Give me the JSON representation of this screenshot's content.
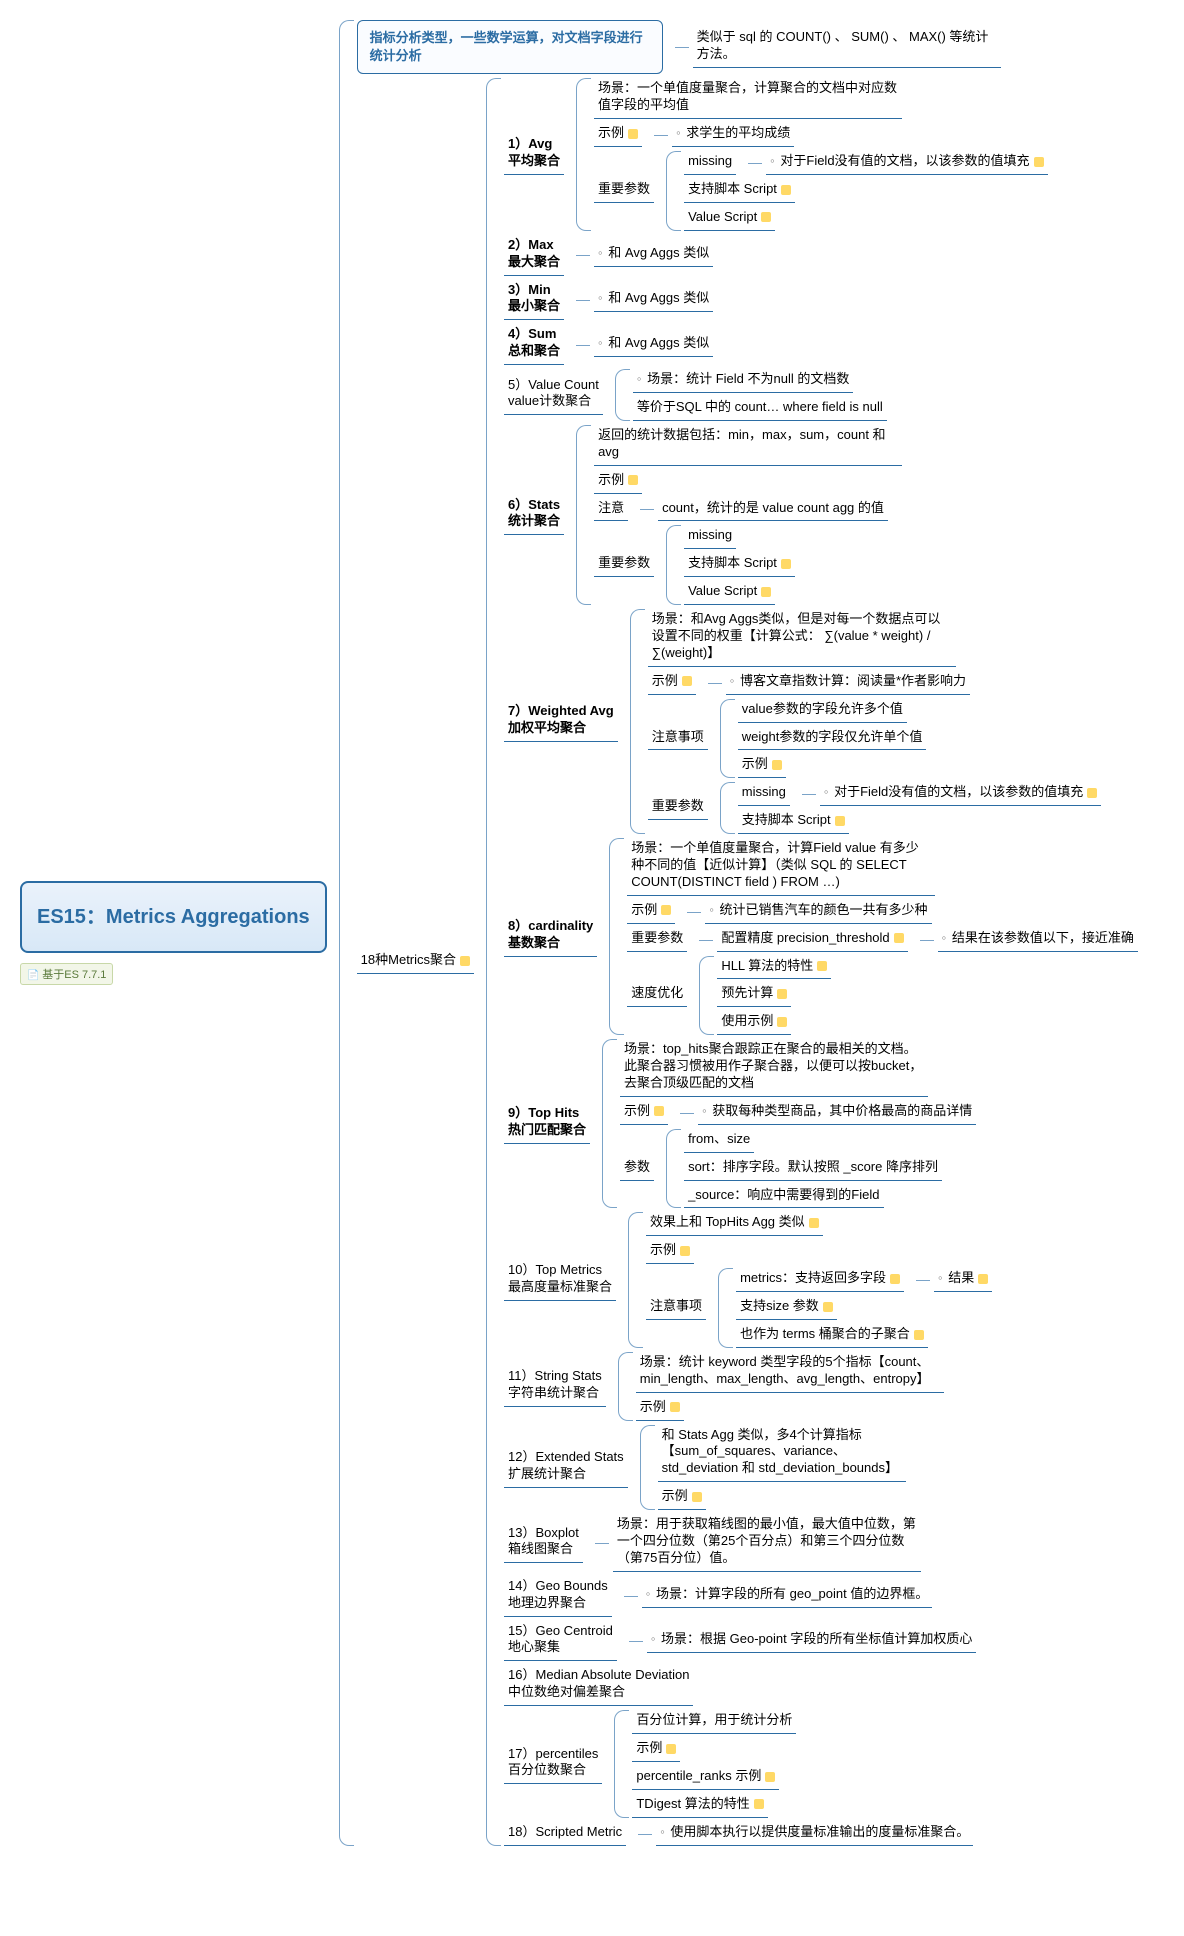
{
  "root": {
    "title": "ES15：Metrics Aggregations",
    "version": "基于ES 7.7.1"
  },
  "b1": {
    "title": "指标分析类型，一些数学运算，对文档字段进行统计分析",
    "desc": "类似于 sql 的 COUNT()  、 SUM()  、 MAX() 等统计方法。"
  },
  "b2": {
    "title": "18种Metrics聚合"
  },
  "m1": {
    "title": "1）Avg\n平均聚合",
    "scene": "场景：一个单值度量聚合，计算聚合的文档中对应数值字段的平均值",
    "ex_label": "示例",
    "ex": "求学生的平均成绩",
    "p_label": "重要参数",
    "p1": "missing",
    "p1d": "对于Field没有值的文档，以该参数的值填充",
    "p2": "支持脚本 Script",
    "p3": "Value Script"
  },
  "m2": {
    "title": "2）Max\n最大聚合",
    "desc": "和 Avg Aggs 类似"
  },
  "m3": {
    "title": "3）Min\n最小聚合",
    "desc": "和 Avg Aggs 类似"
  },
  "m4": {
    "title": "4）Sum\n总和聚合",
    "desc": "和 Avg Aggs 类似"
  },
  "m5": {
    "title": "5）Value Count\nvalue计数聚合",
    "d1": "场景：统计 Field 不为null 的文档数",
    "d2": "等价于SQL 中的 count… where field is null"
  },
  "m6": {
    "title": "6）Stats\n统计聚合",
    "d1": "返回的统计数据包括：min，max，sum，count 和 avg",
    "ex": "示例",
    "note_label": "注意",
    "note": "count，统计的是 value count agg 的值",
    "p_label": "重要参数",
    "p1": "missing",
    "p2": "支持脚本 Script",
    "p3": "Value Script"
  },
  "m7": {
    "title": "7）Weighted Avg\n加权平均聚合",
    "scene": "场景：和Avg Aggs类似，但是对每一个数据点可以设置不同的权重【计算公式： ∑(value * weight) / ∑(weight)】",
    "ex_label": "示例",
    "ex": "博客文章指数计算：阅读量*作者影响力",
    "n_label": "注意事项",
    "n1": "value参数的字段允许多个值",
    "n2": "weight参数的字段仅允许单个值",
    "n3": "示例",
    "p_label": "重要参数",
    "p1": "missing",
    "p1d": "对于Field没有值的文档，以该参数的值填充",
    "p2": "支持脚本 Script"
  },
  "m8": {
    "title": "8）cardinality\n基数聚合",
    "scene": "场景：一个单值度量聚合，计算Field value 有多少种不同的值【近似计算】（类似 SQL 的 SELECT COUNT(DISTINCT field ) FROM …)",
    "ex_label": "示例",
    "ex": "统计已销售汽车的颜色一共有多少种",
    "p_label": "重要参数",
    "p1": "配置精度 precision_threshold",
    "p1d": "结果在该参数值以下，接近准确",
    "s_label": "速度优化",
    "s1": "HLL 算法的特性",
    "s2": "预先计算",
    "s3": "使用示例"
  },
  "m9": {
    "title": "9）Top Hits\n热门匹配聚合",
    "scene": "场景：top_hits聚合跟踪正在聚合的最相关的文档。此聚合器习惯被用作子聚合器，以便可以按bucket，去聚合顶级匹配的文档",
    "ex_label": "示例",
    "ex": "获取每种类型商品，其中价格最高的商品详情",
    "p_label": "参数",
    "p1": "from、size",
    "p2": "sort：排序字段。默认按照 _score 降序排列",
    "p3": "_source：响应中需要得到的Field"
  },
  "m10": {
    "title": "10）Top Metrics\n最高度量标准聚合",
    "d1": "效果上和 TopHits Agg 类似",
    "ex": "示例",
    "n_label": "注意事项",
    "n1": "metrics：支持返回多字段",
    "n1r": "结果",
    "n2": "支持size 参数",
    "n3": "也作为 terms 桶聚合的子聚合"
  },
  "m11": {
    "title": "11）String Stats\n字符串统计聚合",
    "d1": "场景：统计 keyword 类型字段的5个指标【count、min_length、max_length、avg_length、entropy】",
    "ex": "示例"
  },
  "m12": {
    "title": "12）Extended Stats\n扩展统计聚合",
    "d1": "和 Stats Agg 类似，多4个计算指标【sum_of_squares、variance、std_deviation 和 std_deviation_bounds】",
    "ex": "示例"
  },
  "m13": {
    "title": "13）Boxplot\n箱线图聚合",
    "d1": "场景：用于获取箱线图的最小值，最大值中位数，第一个四分位数（第25个百分点）和第三个四分位数（第75百分位）值。"
  },
  "m14": {
    "title": "14）Geo Bounds\n地理边界聚合",
    "d1": "场景：计算字段的所有 geo_point 值的边界框。"
  },
  "m15": {
    "title": "15）Geo Centroid\n地心聚集",
    "d1": "场景：根据 Geo-point 字段的所有坐标值计算加权质心"
  },
  "m16": {
    "title": "16）Median Absolute Deviation\n中位数绝对偏差聚合"
  },
  "m17": {
    "title": "17）percentiles\n百分位数聚合",
    "d1": "百分位计算，用于统计分析",
    "d2": "示例",
    "d3": "percentile_ranks 示例",
    "d4": "TDigest 算法的特性"
  },
  "m18": {
    "title": "18）Scripted Metric",
    "d1": "使用脚本执行以提供度量标准输出的度量标准聚合。"
  }
}
